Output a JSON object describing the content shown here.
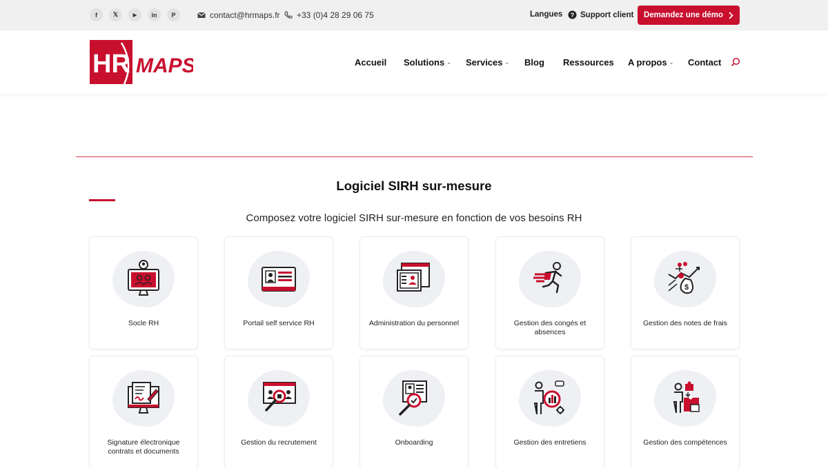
{
  "topbar": {
    "social": [
      {
        "icon": "facebook-icon",
        "glyph": "f"
      },
      {
        "icon": "x-twitter-icon",
        "glyph": "𝕏"
      },
      {
        "icon": "youtube-icon",
        "glyph": "▶"
      },
      {
        "icon": "linkedin-icon",
        "glyph": "in"
      },
      {
        "icon": "pinterest-icon",
        "glyph": "P"
      }
    ],
    "email": "contact@hrmaps.fr",
    "phone": "+33 (0)4 28 29 06 75",
    "languages": "Langues",
    "support": "Support client",
    "demo": "Demandez une démo"
  },
  "header": {
    "logo_text_left": "HR",
    "logo_text_right": "MAPS",
    "nav": [
      {
        "label": "Accueil",
        "caret": false
      },
      {
        "label": "Solutions",
        "caret": true
      },
      {
        "label": "Services",
        "caret": true
      },
      {
        "label": "Blog",
        "caret": false
      },
      {
        "label": "Ressources",
        "caret": false
      },
      {
        "label": "A propos",
        "caret": true
      },
      {
        "label": "Contact",
        "caret": false
      }
    ]
  },
  "section": {
    "title": "Logiciel SIRH sur-mesure",
    "subtitle": "Composez votre logiciel SIRH sur-mesure en fonction de vos besoins RH"
  },
  "modules": [
    {
      "label": "Socle RH",
      "icon": "monitor-users-icon"
    },
    {
      "label": "Portail self service RH",
      "icon": "id-card-icon"
    },
    {
      "label": "Administration du personnel",
      "icon": "admin-screen-icon"
    },
    {
      "label": "Gestion des congés et absences",
      "icon": "running-person-icon"
    },
    {
      "label": "Gestion des notes de frais",
      "icon": "money-bag-icon"
    },
    {
      "label": "Signature électronique contrats et documents",
      "icon": "e-signature-icon"
    },
    {
      "label": "Gestion du recrutement",
      "icon": "recruitment-search-icon"
    },
    {
      "label": "Onboarding",
      "icon": "onboarding-check-icon"
    },
    {
      "label": "Gestion des entretiens",
      "icon": "interview-chart-icon"
    },
    {
      "label": "Gestion des compétences",
      "icon": "skills-puzzle-icon"
    }
  ],
  "colors": {
    "accent": "#c8102e",
    "topbar_bg": "#f0f0f0"
  }
}
